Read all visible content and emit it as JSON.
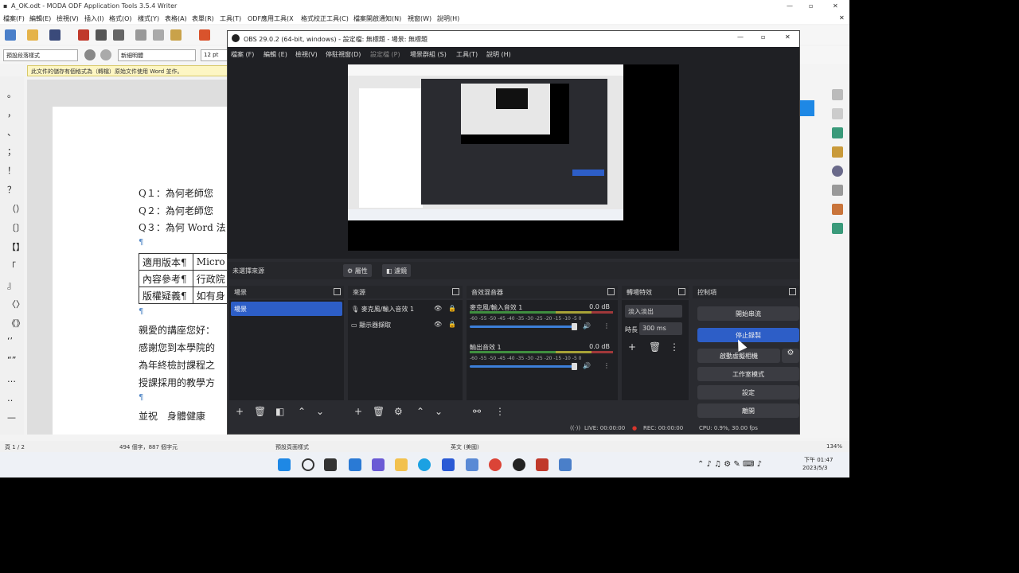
{
  "writer": {
    "title": "A_OK.odt - MODA ODF Application Tools 3.5.4 Writer",
    "menu": [
      "檔案(F)",
      "編輯(E)",
      "檢視(V)",
      "插入(I)",
      "格式(O)",
      "樣式(Y)",
      "表格(A)",
      "表單(R)",
      "工具(T)",
      "ODF應用工具(X",
      "格式校正工具(C)",
      "檔案開啟通知(N)",
      "視窗(W)",
      "說明(H)"
    ],
    "style_combo": "預設段落樣式",
    "font_combo": "新細明體",
    "size_combo": "12 pt",
    "infobar": "此文件的儲存有個格式為（轉檔）原始文件使用 Word 並作。",
    "lines": {
      "q1": "Q１：為何老師您",
      "q2": "Q２：為何老師您",
      "q3": "Q３：為何 Word 法"
    },
    "table": [
      [
        "適用版本¶",
        "Micro"
      ],
      [
        "內容參考¶",
        "行政院"
      ],
      [
        "版權疑義¶",
        "如有身"
      ]
    ],
    "para_mark": "¶",
    "body": {
      "l1": "親愛的講座您好：",
      "l2": "感謝您到本學院的",
      "l3": "為年終檢討課程之",
      "l4": "授課採用的教學方",
      "l5": "並祝　身體健康"
    },
    "status": {
      "page": "頁 1 / 2",
      "words": "494 個字，887 個字元",
      "style": "預設頁面樣式",
      "lang": "英文 (美國)",
      "zoom": "134%"
    }
  },
  "taskbar": {
    "time": "下午 01:47",
    "date": "2023/5/3"
  },
  "obs": {
    "title": "OBS 29.0.2 (64-bit, windows) - 設定檔: 無標題 - 場景: 無標題",
    "menu": [
      "檔案 (F)",
      "編輯 (E)",
      "檢視(V)",
      "停駐視窗(D)",
      "設定檔 (P)",
      "場景群組 (S)",
      "工具(T)",
      "說明 (H)"
    ],
    "no_source": "未選擇來源",
    "properties": "屬性",
    "filters": "濾鏡",
    "scenes": {
      "title": "場景",
      "items": [
        "場景"
      ]
    },
    "sources": {
      "title": "來源",
      "items": [
        "麥克風/輸入音效 1",
        "顯示器擷取"
      ]
    },
    "mixer": {
      "title": "音效混音器",
      "channels": [
        {
          "name": "麥克風/輸入音效 1",
          "db": "0.0 dB"
        },
        {
          "name": "輸出音效 1",
          "db": "0.0 dB"
        }
      ],
      "scale": "-60 -55 -50 -45 -40 -35 -30 -25 -20 -15 -10 -5 0"
    },
    "transitions": {
      "title": "轉場特效",
      "type": "淡入淡出",
      "duration_label": "時長",
      "duration": "300 ms"
    },
    "controls": {
      "title": "控制項",
      "buttons": [
        "開始串流",
        "停止錄製",
        "啟動虛擬相機",
        "工作室模式",
        "設定",
        "離開"
      ]
    },
    "status": {
      "live": "LIVE: 00:00:00",
      "rec": "REC: 00:00:00",
      "cpu": "CPU: 0.9%, 30.00 fps"
    }
  }
}
